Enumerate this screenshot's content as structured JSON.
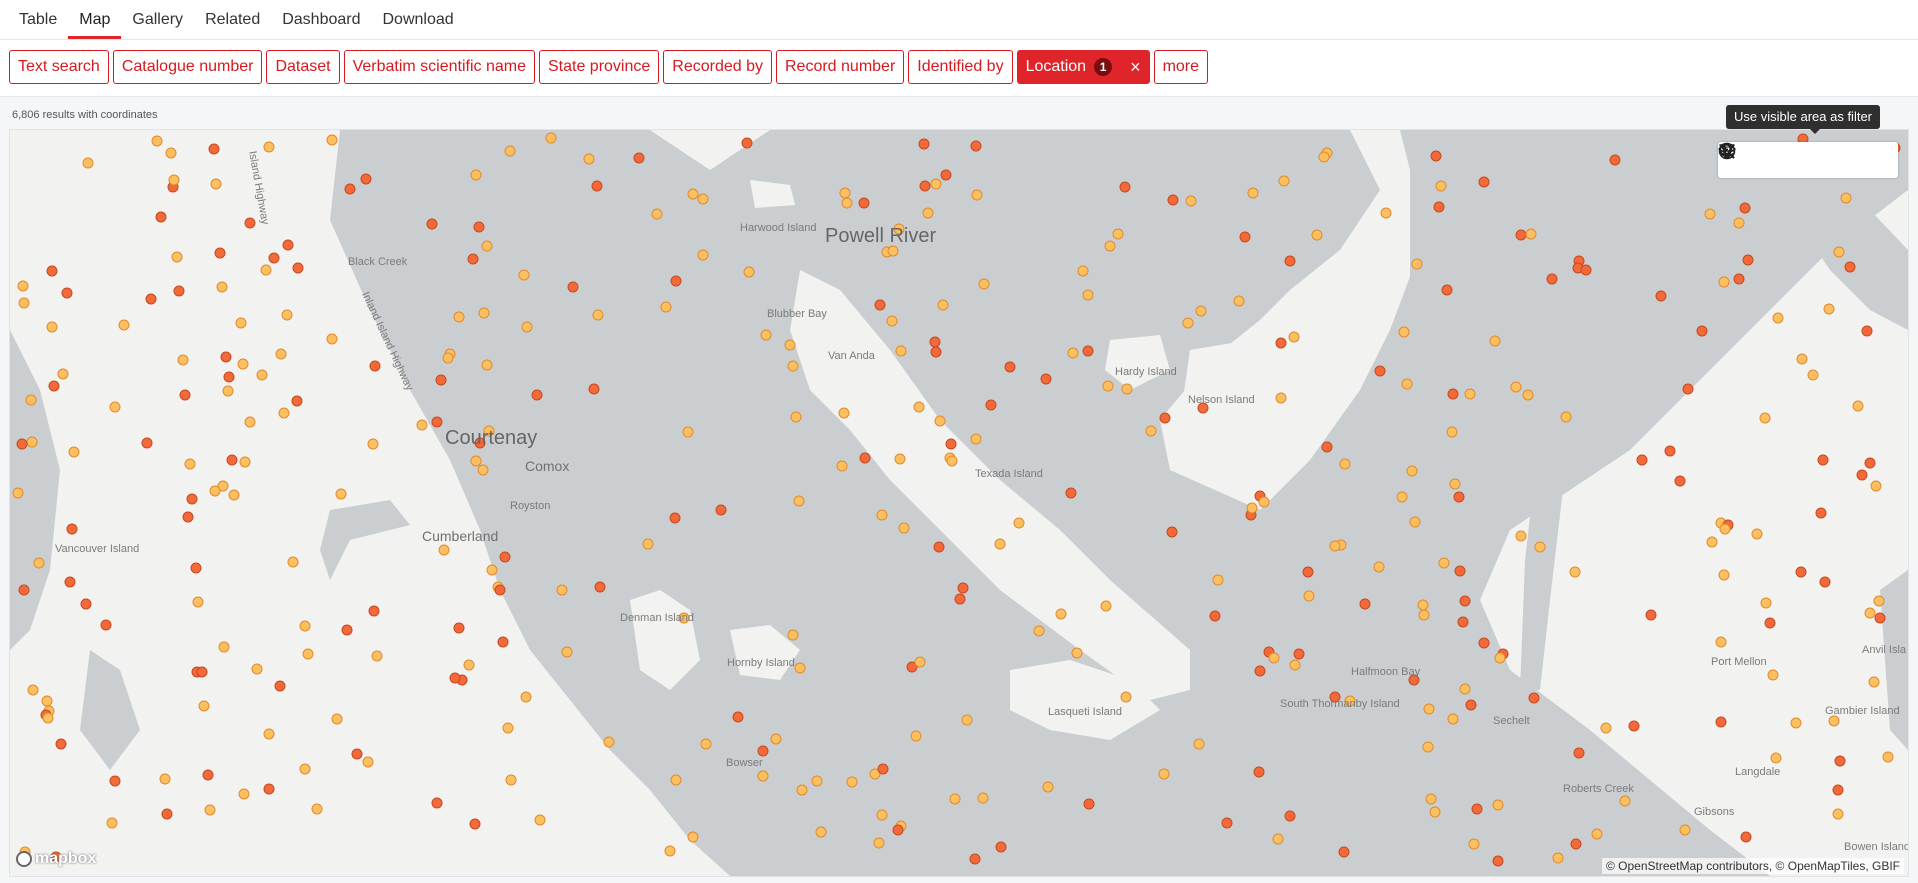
{
  "tabs": [
    {
      "label": "Table",
      "active": false
    },
    {
      "label": "Map",
      "active": true
    },
    {
      "label": "Gallery",
      "active": false
    },
    {
      "label": "Related",
      "active": false
    },
    {
      "label": "Dashboard",
      "active": false
    },
    {
      "label": "Download",
      "active": false
    }
  ],
  "filters": [
    {
      "label": "Text search"
    },
    {
      "label": "Catalogue number"
    },
    {
      "label": "Dataset"
    },
    {
      "label": "Verbatim scientific name"
    },
    {
      "label": "State province"
    },
    {
      "label": "Recorded by"
    },
    {
      "label": "Record number"
    },
    {
      "label": "Identified by"
    },
    {
      "label": "Location",
      "active": true,
      "count": "1",
      "clear": "×"
    },
    {
      "label": "more"
    }
  ],
  "results_text": "6,806 results with coordinates",
  "tooltip": "Use visible area as filter",
  "map_controls": [
    "zoom-in-icon",
    "zoom-out-icon",
    "filter-icon",
    "globe-icon",
    "layers-icon"
  ],
  "place_labels": [
    {
      "text": "Powell River",
      "size": "big"
    },
    {
      "text": "Courtenay",
      "size": "big"
    },
    {
      "text": "Comox",
      "size": "mid"
    },
    {
      "text": "Cumberland",
      "size": "mid"
    },
    {
      "text": "Harwood Island",
      "size": "small"
    },
    {
      "text": "Blubber Bay",
      "size": "small"
    },
    {
      "text": "Van Anda",
      "size": "small"
    },
    {
      "text": "Black Creek",
      "size": "small"
    },
    {
      "text": "Vancouver Island",
      "size": "small"
    },
    {
      "text": "Royston",
      "size": "small"
    },
    {
      "text": "Hardy Island",
      "size": "small"
    },
    {
      "text": "Nelson Island",
      "size": "small"
    },
    {
      "text": "Texada Island",
      "size": "small"
    },
    {
      "text": "Denman Island",
      "size": "small"
    },
    {
      "text": "Hornby Island",
      "size": "small"
    },
    {
      "text": "Lasqueti Island",
      "size": "small"
    },
    {
      "text": "Bowser",
      "size": "small"
    },
    {
      "text": "Halfmoon Bay",
      "size": "small"
    },
    {
      "text": "South Thormanby Island",
      "size": "small"
    },
    {
      "text": "Sechelt",
      "size": "small"
    },
    {
      "text": "Port Mellon",
      "size": "small"
    },
    {
      "text": "Gambier Island",
      "size": "small"
    },
    {
      "text": "Langdale",
      "size": "small"
    },
    {
      "text": "Roberts Creek",
      "size": "small"
    },
    {
      "text": "Gibsons",
      "size": "small"
    },
    {
      "text": "Anvil Isla",
      "size": "small"
    },
    {
      "text": "Bowen Island",
      "size": "small"
    },
    {
      "text": "Island Highway",
      "size": "small"
    },
    {
      "text": "Inland Island Highway",
      "size": "small"
    }
  ],
  "attribution": "© OpenStreetMap contributors, © OpenMapTiles, GBIF",
  "logo": "mapbox",
  "colors": {
    "accent": "#e0252a",
    "water": "#cbced0",
    "land": "#f2f2f1",
    "point_high": "#f26a3a",
    "point_low": "#fdc061"
  }
}
